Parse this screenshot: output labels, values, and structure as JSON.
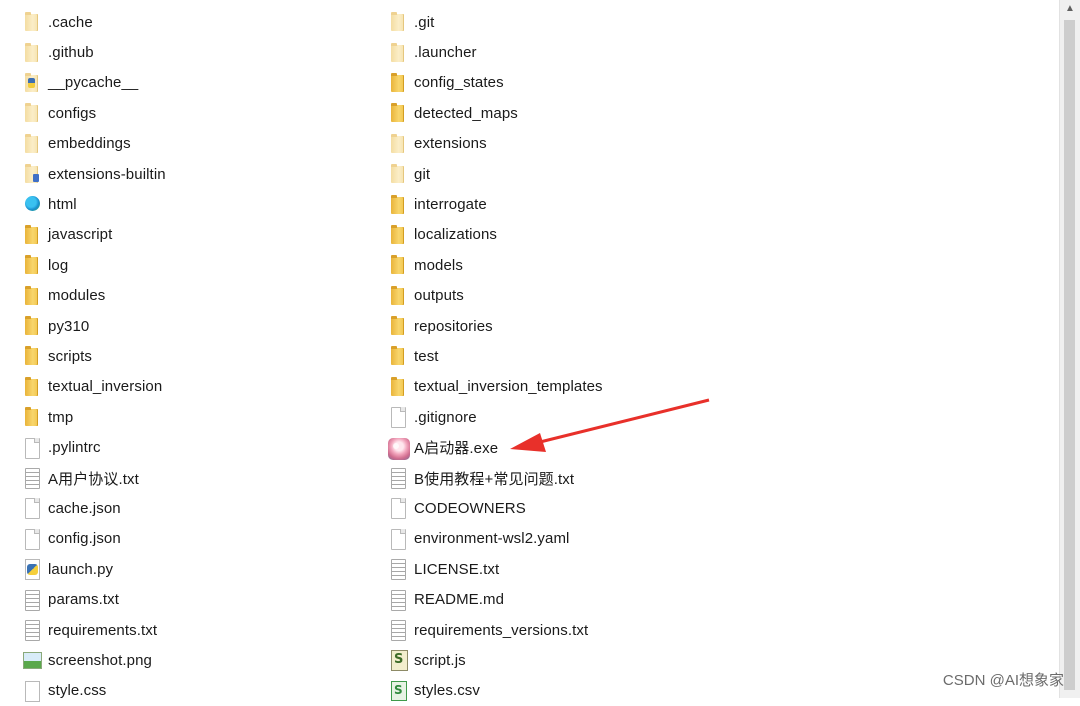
{
  "left_column": [
    {
      "label": ".cache",
      "icon": "folder-light-icon"
    },
    {
      "label": ".github",
      "icon": "folder-light-icon"
    },
    {
      "label": "__pycache__",
      "icon": "python-folder-icon"
    },
    {
      "label": "configs",
      "icon": "folder-light-icon"
    },
    {
      "label": "embeddings",
      "icon": "folder-light-icon"
    },
    {
      "label": "extensions-builtin",
      "icon": "folder-ext-icon"
    },
    {
      "label": "html",
      "icon": "html-folder-icon"
    },
    {
      "label": "javascript",
      "icon": "folder-icon"
    },
    {
      "label": "log",
      "icon": "folder-icon"
    },
    {
      "label": "modules",
      "icon": "folder-icon"
    },
    {
      "label": "py310",
      "icon": "folder-icon"
    },
    {
      "label": "scripts",
      "icon": "folder-icon"
    },
    {
      "label": "textual_inversion",
      "icon": "folder-icon"
    },
    {
      "label": "tmp",
      "icon": "folder-icon"
    },
    {
      "label": ".pylintrc",
      "icon": "file-icon"
    },
    {
      "label": "A用户协议.txt",
      "icon": "text-file-icon"
    },
    {
      "label": "cache.json",
      "icon": "file-icon"
    },
    {
      "label": "config.json",
      "icon": "file-icon"
    },
    {
      "label": "launch.py",
      "icon": "python-file-icon"
    },
    {
      "label": "params.txt",
      "icon": "text-file-icon"
    },
    {
      "label": "requirements.txt",
      "icon": "text-file-icon"
    },
    {
      "label": "screenshot.png",
      "icon": "image-file-icon"
    },
    {
      "label": "style.css",
      "icon": "css-file-icon"
    }
  ],
  "right_column": [
    {
      "label": ".git",
      "icon": "folder-light-icon"
    },
    {
      "label": ".launcher",
      "icon": "folder-light-icon"
    },
    {
      "label": "config_states",
      "icon": "folder-icon"
    },
    {
      "label": "detected_maps",
      "icon": "folder-icon"
    },
    {
      "label": "extensions",
      "icon": "folder-light-icon"
    },
    {
      "label": "git",
      "icon": "folder-light-icon"
    },
    {
      "label": "interrogate",
      "icon": "folder-icon"
    },
    {
      "label": "localizations",
      "icon": "folder-icon"
    },
    {
      "label": "models",
      "icon": "folder-icon"
    },
    {
      "label": "outputs",
      "icon": "folder-icon"
    },
    {
      "label": "repositories",
      "icon": "folder-icon"
    },
    {
      "label": "test",
      "icon": "folder-icon"
    },
    {
      "label": "textual_inversion_templates",
      "icon": "folder-icon"
    },
    {
      "label": ".gitignore",
      "icon": "file-icon"
    },
    {
      "label": "A启动器.exe",
      "icon": "exe-app-icon"
    },
    {
      "label": "B使用教程+常见问题.txt",
      "icon": "text-file-icon"
    },
    {
      "label": "CODEOWNERS",
      "icon": "file-icon"
    },
    {
      "label": "environment-wsl2.yaml",
      "icon": "file-icon"
    },
    {
      "label": "LICENSE.txt",
      "icon": "text-file-icon"
    },
    {
      "label": "README.md",
      "icon": "text-file-icon"
    },
    {
      "label": "requirements_versions.txt",
      "icon": "text-file-icon"
    },
    {
      "label": "script.js",
      "icon": "js-file-icon"
    },
    {
      "label": "styles.csv",
      "icon": "csv-file-icon"
    }
  ],
  "annotation": {
    "arrow_color": "#e8302a"
  },
  "watermark": "CSDN @AI想象家"
}
